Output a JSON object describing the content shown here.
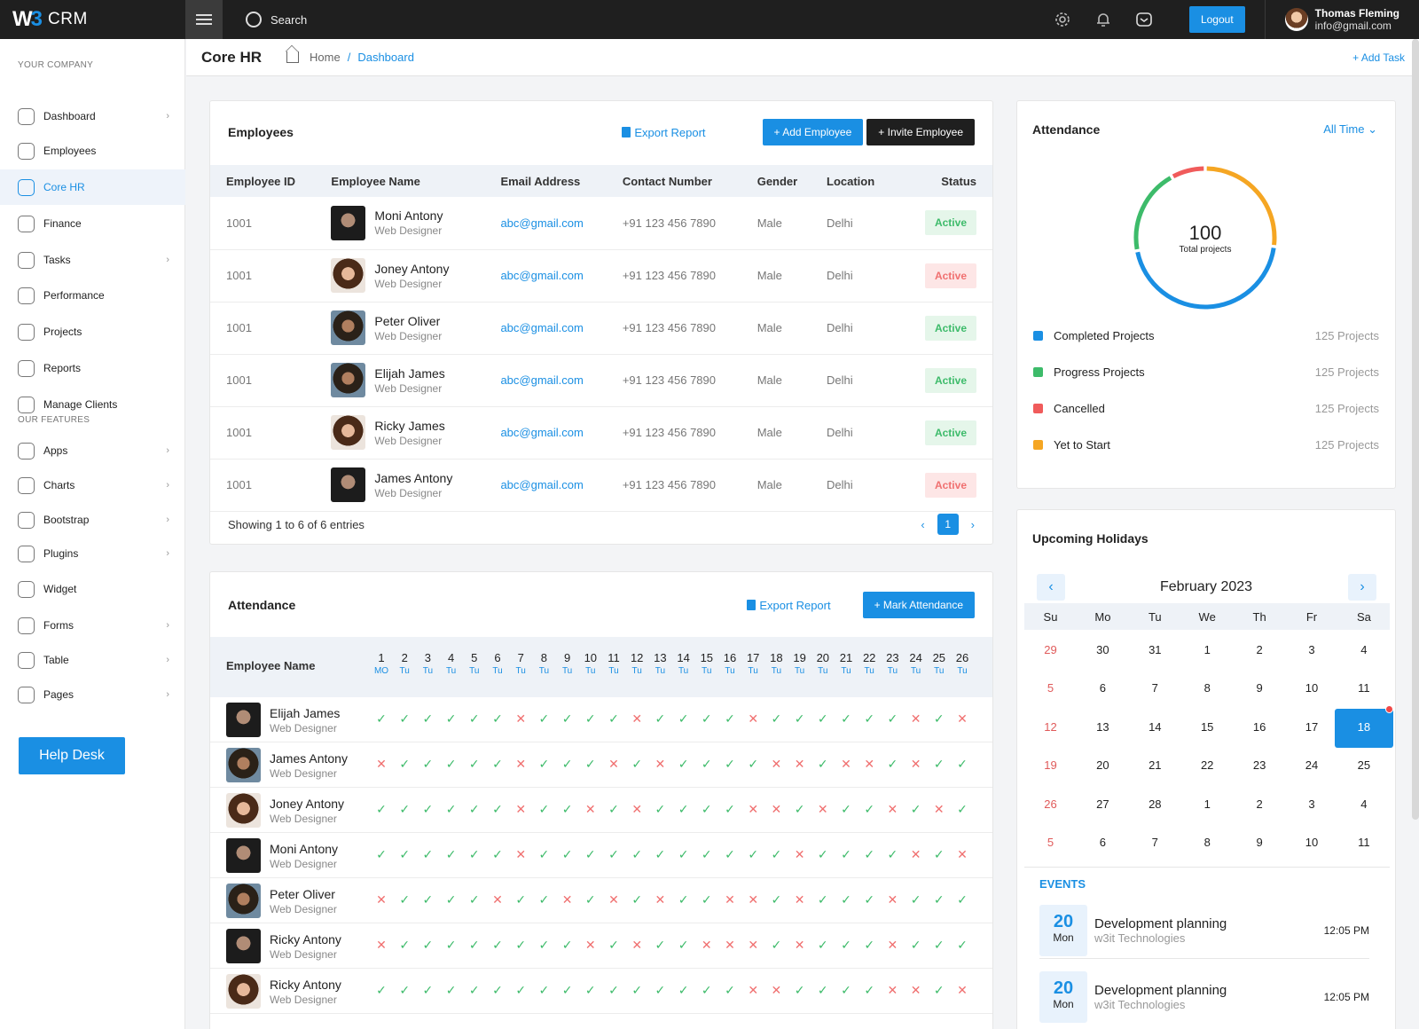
{
  "app": {
    "brand": "CRM"
  },
  "topbar": {
    "search_label": "Search",
    "logout_label": "Logout",
    "user_name": "Thomas Fleming",
    "user_email": "info@gmail.com"
  },
  "sidebar": {
    "section1": "YOUR COMPANY",
    "section2": "OUR FEATURES",
    "items": [
      {
        "label": "Dashboard",
        "chevron": true
      },
      {
        "label": "Employees",
        "chevron": false
      },
      {
        "label": "Core HR",
        "chevron": false,
        "active": true
      },
      {
        "label": "Finance",
        "chevron": false
      },
      {
        "label": "Tasks",
        "chevron": true
      },
      {
        "label": "Performance",
        "chevron": false
      },
      {
        "label": "Projects",
        "chevron": false
      },
      {
        "label": "Reports",
        "chevron": false
      },
      {
        "label": "Manage Clients",
        "chevron": false
      }
    ],
    "features": [
      {
        "label": "Apps",
        "chevron": true
      },
      {
        "label": "Charts",
        "chevron": true
      },
      {
        "label": "Bootstrap",
        "chevron": true
      },
      {
        "label": "Plugins",
        "chevron": true
      },
      {
        "label": "Widget",
        "chevron": false
      },
      {
        "label": "Forms",
        "chevron": true
      },
      {
        "label": "Table",
        "chevron": true
      },
      {
        "label": "Pages",
        "chevron": true
      }
    ],
    "help_label": "Help Desk"
  },
  "header": {
    "title": "Core HR",
    "crumb_home": "Home",
    "crumb_sep": "/",
    "crumb_current": "Dashboard",
    "add_task": "+ Add Task"
  },
  "employees": {
    "title": "Employees",
    "export_label": "Export Report",
    "add_label": "+ Add Employee",
    "invite_label": "+ Invite Employee",
    "columns": [
      "Employee ID",
      "Employee Name",
      "Email Address",
      "Contact Number",
      "Gender",
      "Location",
      "Status"
    ],
    "rows": [
      {
        "id": "1001",
        "name": "Moni Antony",
        "role": "Web Designer",
        "email": "abc@gmail.com",
        "phone": "+91 123 456 7890",
        "gender": "Male",
        "location": "Delhi",
        "status": "Active",
        "status_color": "green",
        "face": "m"
      },
      {
        "id": "1001",
        "name": "Joney Antony",
        "role": "Web Designer",
        "email": "abc@gmail.com",
        "phone": "+91 123 456 7890",
        "gender": "Male",
        "location": "Delhi",
        "status": "Active",
        "status_color": "red",
        "face": "w"
      },
      {
        "id": "1001",
        "name": "Peter Oliver",
        "role": "Web Designer",
        "email": "abc@gmail.com",
        "phone": "+91 123 456 7890",
        "gender": "Male",
        "location": "Delhi",
        "status": "Active",
        "status_color": "green",
        "face": "c"
      },
      {
        "id": "1001",
        "name": "Elijah James",
        "role": "Web Designer",
        "email": "abc@gmail.com",
        "phone": "+91 123 456 7890",
        "gender": "Male",
        "location": "Delhi",
        "status": "Active",
        "status_color": "green",
        "face": "c"
      },
      {
        "id": "1001",
        "name": "Ricky James",
        "role": "Web Designer",
        "email": "abc@gmail.com",
        "phone": "+91 123 456 7890",
        "gender": "Male",
        "location": "Delhi",
        "status": "Active",
        "status_color": "green",
        "face": "w"
      },
      {
        "id": "1001",
        "name": "James Antony",
        "role": "Web Designer",
        "email": "abc@gmail.com",
        "phone": "+91 123 456 7890",
        "gender": "Male",
        "location": "Delhi",
        "status": "Active",
        "status_color": "red",
        "face": "m"
      }
    ],
    "footer": "Showing 1 to 6 of 6 entries",
    "page": "1"
  },
  "attendance_grid": {
    "title": "Attendance",
    "export_label": "Export Report",
    "mark_label": "+ Mark Attendance",
    "name_header": "Employee Name",
    "days": [
      {
        "n": "1",
        "d": "MO"
      },
      {
        "n": "2",
        "d": "Tu"
      },
      {
        "n": "3",
        "d": "Tu"
      },
      {
        "n": "4",
        "d": "Tu"
      },
      {
        "n": "5",
        "d": "Tu"
      },
      {
        "n": "6",
        "d": "Tu"
      },
      {
        "n": "7",
        "d": "Tu"
      },
      {
        "n": "8",
        "d": "Tu"
      },
      {
        "n": "9",
        "d": "Tu"
      },
      {
        "n": "10",
        "d": "Tu"
      },
      {
        "n": "11",
        "d": "Tu"
      },
      {
        "n": "12",
        "d": "Tu"
      },
      {
        "n": "13",
        "d": "Tu"
      },
      {
        "n": "14",
        "d": "Tu"
      },
      {
        "n": "15",
        "d": "Tu"
      },
      {
        "n": "16",
        "d": "Tu"
      },
      {
        "n": "17",
        "d": "Tu"
      },
      {
        "n": "18",
        "d": "Tu"
      },
      {
        "n": "19",
        "d": "Tu"
      },
      {
        "n": "20",
        "d": "Tu"
      },
      {
        "n": "21",
        "d": "Tu"
      },
      {
        "n": "22",
        "d": "Tu"
      },
      {
        "n": "23",
        "d": "Tu"
      },
      {
        "n": "24",
        "d": "Tu"
      },
      {
        "n": "25",
        "d": "Tu"
      },
      {
        "n": "26",
        "d": "Tu"
      }
    ],
    "rows": [
      {
        "name": "Elijah James",
        "role": "Web Designer",
        "face": "m",
        "marks": "yyyyyynyyyynyyyynyyyyyynyny"
      },
      {
        "name": "James Antony",
        "role": "Web Designer",
        "face": "c",
        "marks": "nyyyyynyyynynyyyynnynnynyy"
      },
      {
        "name": "Joney Antony",
        "role": "Web Designer",
        "face": "w",
        "marks": "yyyyyynyynynyyyynnynyynyny"
      },
      {
        "name": "Moni Antony",
        "role": "Web Designer",
        "face": "m",
        "marks": "yyyyyynyyyyyyyyyyynyyyynyny"
      },
      {
        "name": "Peter Oliver",
        "role": "Web Designer",
        "face": "c",
        "marks": "nyyyynyynynynyynnynyyynyyy"
      },
      {
        "name": "Ricky Antony",
        "role": "Web Designer",
        "face": "m",
        "marks": "nyyyyyyyynynyynnnynyyynyyy"
      },
      {
        "name": "Ricky Antony",
        "role": "Web Designer",
        "face": "w",
        "marks": "yyyyyyyyyyyyyyyynnyyyynnyny"
      }
    ]
  },
  "attendance_summary": {
    "title": "Attendance",
    "filter": "All Time",
    "total": "100",
    "total_label": "Total projects",
    "legend": [
      {
        "label": "Completed Projects",
        "value": "125 Projects",
        "color": "#1a8fe3"
      },
      {
        "label": "Progress Projects",
        "value": "125 Projects",
        "color": "#3dbb6a"
      },
      {
        "label": "Cancelled",
        "value": "125 Projects",
        "color": "#f05b5b"
      },
      {
        "label": "Yet to Start",
        "value": "125 Projects",
        "color": "#f5a623"
      }
    ],
    "chart_data": {
      "type": "pie",
      "categories": [
        "Completed Projects",
        "Progress Projects",
        "Cancelled",
        "Yet to Start"
      ],
      "values": [
        45,
        20,
        8,
        27
      ],
      "title": "",
      "total": 100
    }
  },
  "holidays": {
    "title": "Upcoming Holidays",
    "month": "February 2023",
    "weekdays": [
      "Su",
      "Mo",
      "Tu",
      "We",
      "Th",
      "Fr",
      "Sa"
    ],
    "weeks": [
      [
        "29",
        "30",
        "31",
        "1",
        "2",
        "3",
        "4"
      ],
      [
        "5",
        "6",
        "7",
        "8",
        "9",
        "10",
        "11"
      ],
      [
        "12",
        "13",
        "14",
        "15",
        "16",
        "17",
        "18"
      ],
      [
        "19",
        "20",
        "21",
        "22",
        "23",
        "24",
        "25"
      ],
      [
        "26",
        "27",
        "28",
        "1",
        "2",
        "3",
        "4"
      ],
      [
        "5",
        "6",
        "7",
        "8",
        "9",
        "10",
        "11"
      ]
    ],
    "selected": "18",
    "events_label": "EVENTS",
    "events": [
      {
        "day": "20",
        "weekday": "Mon",
        "title": "Development planning",
        "company": "w3it Technologies",
        "time": "12:05 PM"
      },
      {
        "day": "20",
        "weekday": "Mon",
        "title": "Development planning",
        "company": "w3it Technologies",
        "time": "12:05 PM"
      }
    ]
  }
}
